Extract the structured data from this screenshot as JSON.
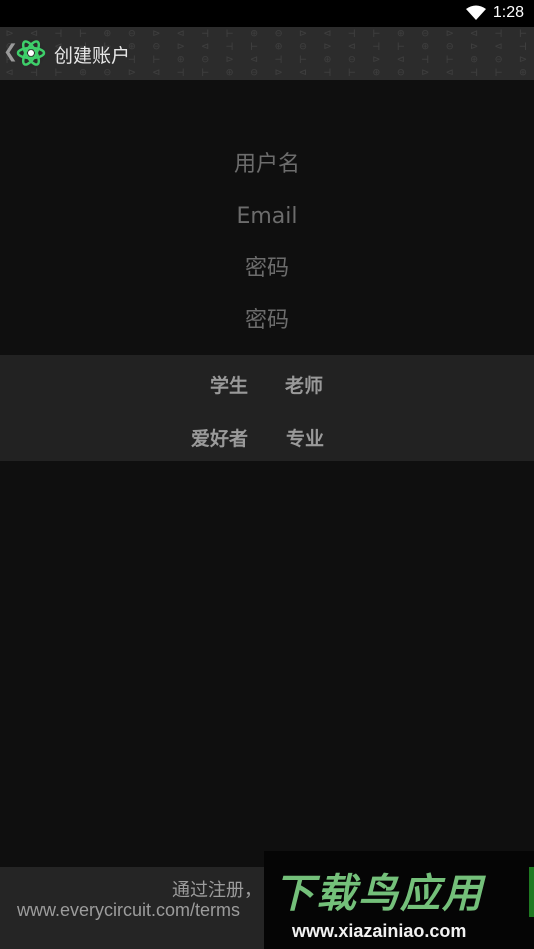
{
  "status": {
    "time": "1:28"
  },
  "header": {
    "title": "创建账户",
    "pattern_row1": "⊳ ⊲ ⊣ ⊢ ⊕ ⊖ ⊳ ⊲ ⊣ ⊢ ⊕ ⊖ ⊳ ⊲ ⊣ ⊢ ⊕ ⊖ ⊳ ⊲ ⊣ ⊢ ⊕",
    "pattern_row2": "⊖ ⊳ ⊲ ⊣ ⊢ ⊕ ⊖ ⊳ ⊲ ⊣ ⊢ ⊕ ⊖ ⊳ ⊲ ⊣ ⊢ ⊕ ⊖ ⊳ ⊲ ⊣",
    "pattern_row3": "⊢ ⊕ ⊖ ⊳ ⊲ ⊣ ⊢ ⊕ ⊖ ⊳ ⊲ ⊣ ⊢ ⊕ ⊖ ⊳ ⊲ ⊣ ⊢ ⊕ ⊖ ⊳ ⊲",
    "pattern_row4": "⊲ ⊣ ⊢ ⊕ ⊖ ⊳ ⊲ ⊣ ⊢ ⊕ ⊖ ⊳ ⊲ ⊣ ⊢ ⊕ ⊖ ⊳ ⊲ ⊣ ⊢ ⊕ ⊖"
  },
  "form": {
    "username_placeholder": "用户名",
    "email_placeholder": "Email",
    "password_placeholder": "密码",
    "confirm_password_placeholder": "密码"
  },
  "roles": {
    "student": "学生",
    "teacher": "老师",
    "hobbyist": "爱好者",
    "professional": "专业"
  },
  "footer": {
    "line1": "通过注册，",
    "line2": "www.everycircuit.com/terms"
  },
  "watermark": {
    "text": "下载鸟应用",
    "url": "www.xiazainiao.com"
  },
  "colors": {
    "background": "#0f0f0f",
    "actionbar": "#2c2c2c",
    "roles_panel": "#222222",
    "logo_green": "#3ecf6a"
  }
}
